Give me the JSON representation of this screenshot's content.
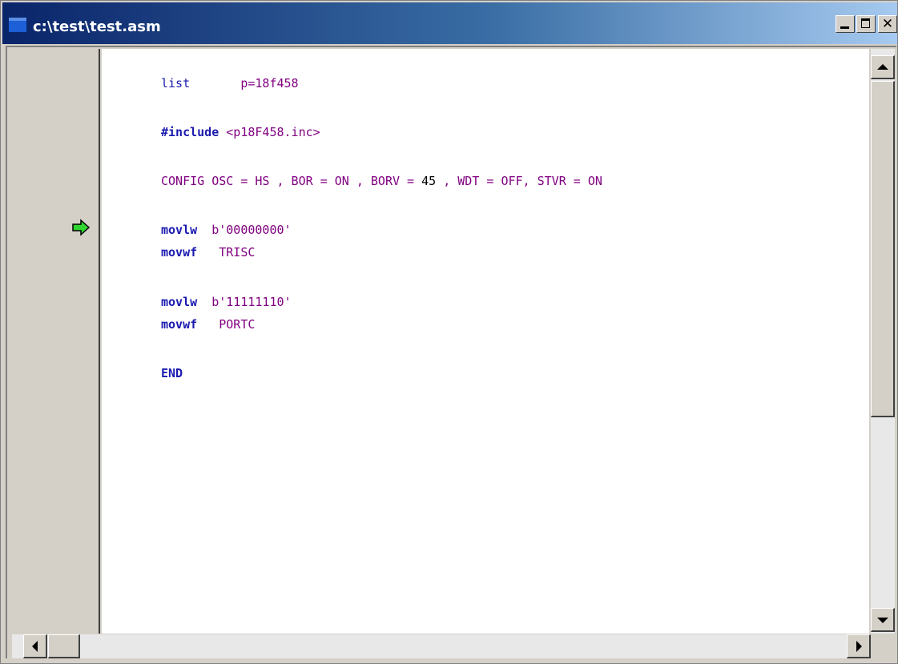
{
  "window": {
    "title": "c:\\test\\test.asm"
  },
  "code": {
    "l1_kw": "list",
    "l1_val": "p=18f458",
    "l2_dir": "#include",
    "l2_val": "<p18F458.inc>",
    "l3_a": "CONFIG OSC = HS , BOR = ON , BORV = ",
    "l3_num": "45",
    "l3_b": " , WDT = OFF, STVR = ON",
    "l4_op": "movlw",
    "l4_arg": "b'00000000'",
    "l5_op": "movwf",
    "l5_arg": "TRISC",
    "l6_op": "movlw",
    "l6_arg": "b'11111110'",
    "l7_op": "movwf",
    "l7_arg": "PORTC",
    "l8_dir": "END"
  },
  "icons": {
    "execution_pointer": "green-arrow-icon",
    "scroll_up": "scroll-up-icon",
    "scroll_down": "scroll-down-icon",
    "scroll_left": "scroll-left-icon",
    "scroll_right": "scroll-right-icon"
  },
  "colors": {
    "keyword": "#1a1ab0",
    "symbol": "#800080",
    "pointer": "#2fd62f"
  }
}
